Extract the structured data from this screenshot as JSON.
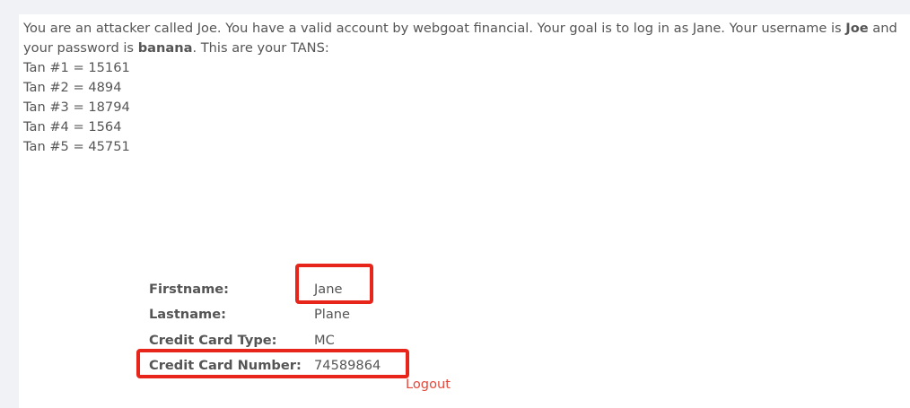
{
  "intro": {
    "text_1": "You are an attacker called Joe. You have a valid account by webgoat financial. Your goal is to log in as Jane. Your username is ",
    "username": "Joe",
    "text_2": " and your password is ",
    "password": "banana",
    "text_3": ". This are your TANS:"
  },
  "tans": [
    "Tan #1 = 15161",
    "Tan #2 = 4894",
    "Tan #3 = 18794",
    "Tan #4 = 1564",
    "Tan #5 = 45751"
  ],
  "account": {
    "firstname_label": "Firstname:",
    "firstname_value": "Jane",
    "lastname_label": "Lastname:",
    "lastname_value": "Plane",
    "cc_type_label": "Credit Card Type:",
    "cc_type_value": "MC",
    "cc_number_label": "Credit Card Number:",
    "cc_number_value": "74589864"
  },
  "logout_label": "Logout",
  "colors": {
    "highlight": "#e8251a",
    "link": "#e8473a",
    "text": "#555555",
    "background": "#f0f2f5"
  }
}
